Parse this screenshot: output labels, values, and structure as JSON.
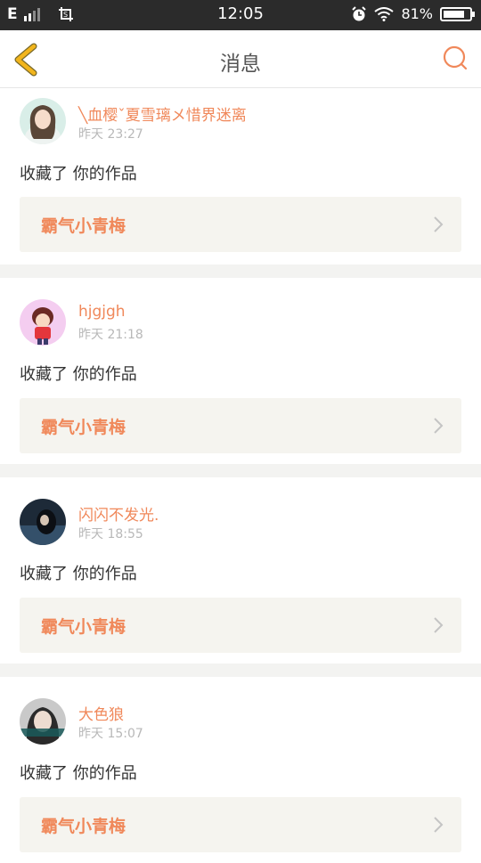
{
  "status_bar": {
    "carrier": "E",
    "time": "12:05",
    "battery_percent": "81%",
    "battery_level": 0.81
  },
  "header": {
    "title": "消息"
  },
  "messages": [
    {
      "username": "╲血樱ˇ夏雪璃メ惜界迷离",
      "time": "昨天 23:27",
      "action": "收藏了 你的作品",
      "work": "霸气小青梅"
    },
    {
      "username": "hjgjgh",
      "time": "昨天 21:18",
      "action": "收藏了 你的作品",
      "work": "霸气小青梅"
    },
    {
      "username": "闪闪不发光.",
      "time": "昨天 18:55",
      "action": "收藏了 你的作品",
      "work": "霸气小青梅"
    },
    {
      "username": "大色狼",
      "time": "昨天 15:07",
      "action": "收藏了 你的作品",
      "work": "霸气小青梅"
    }
  ],
  "colors": {
    "accent": "#f0885a",
    "back_arrow": "#f2b51c",
    "card_box": "#f5f4ef"
  }
}
